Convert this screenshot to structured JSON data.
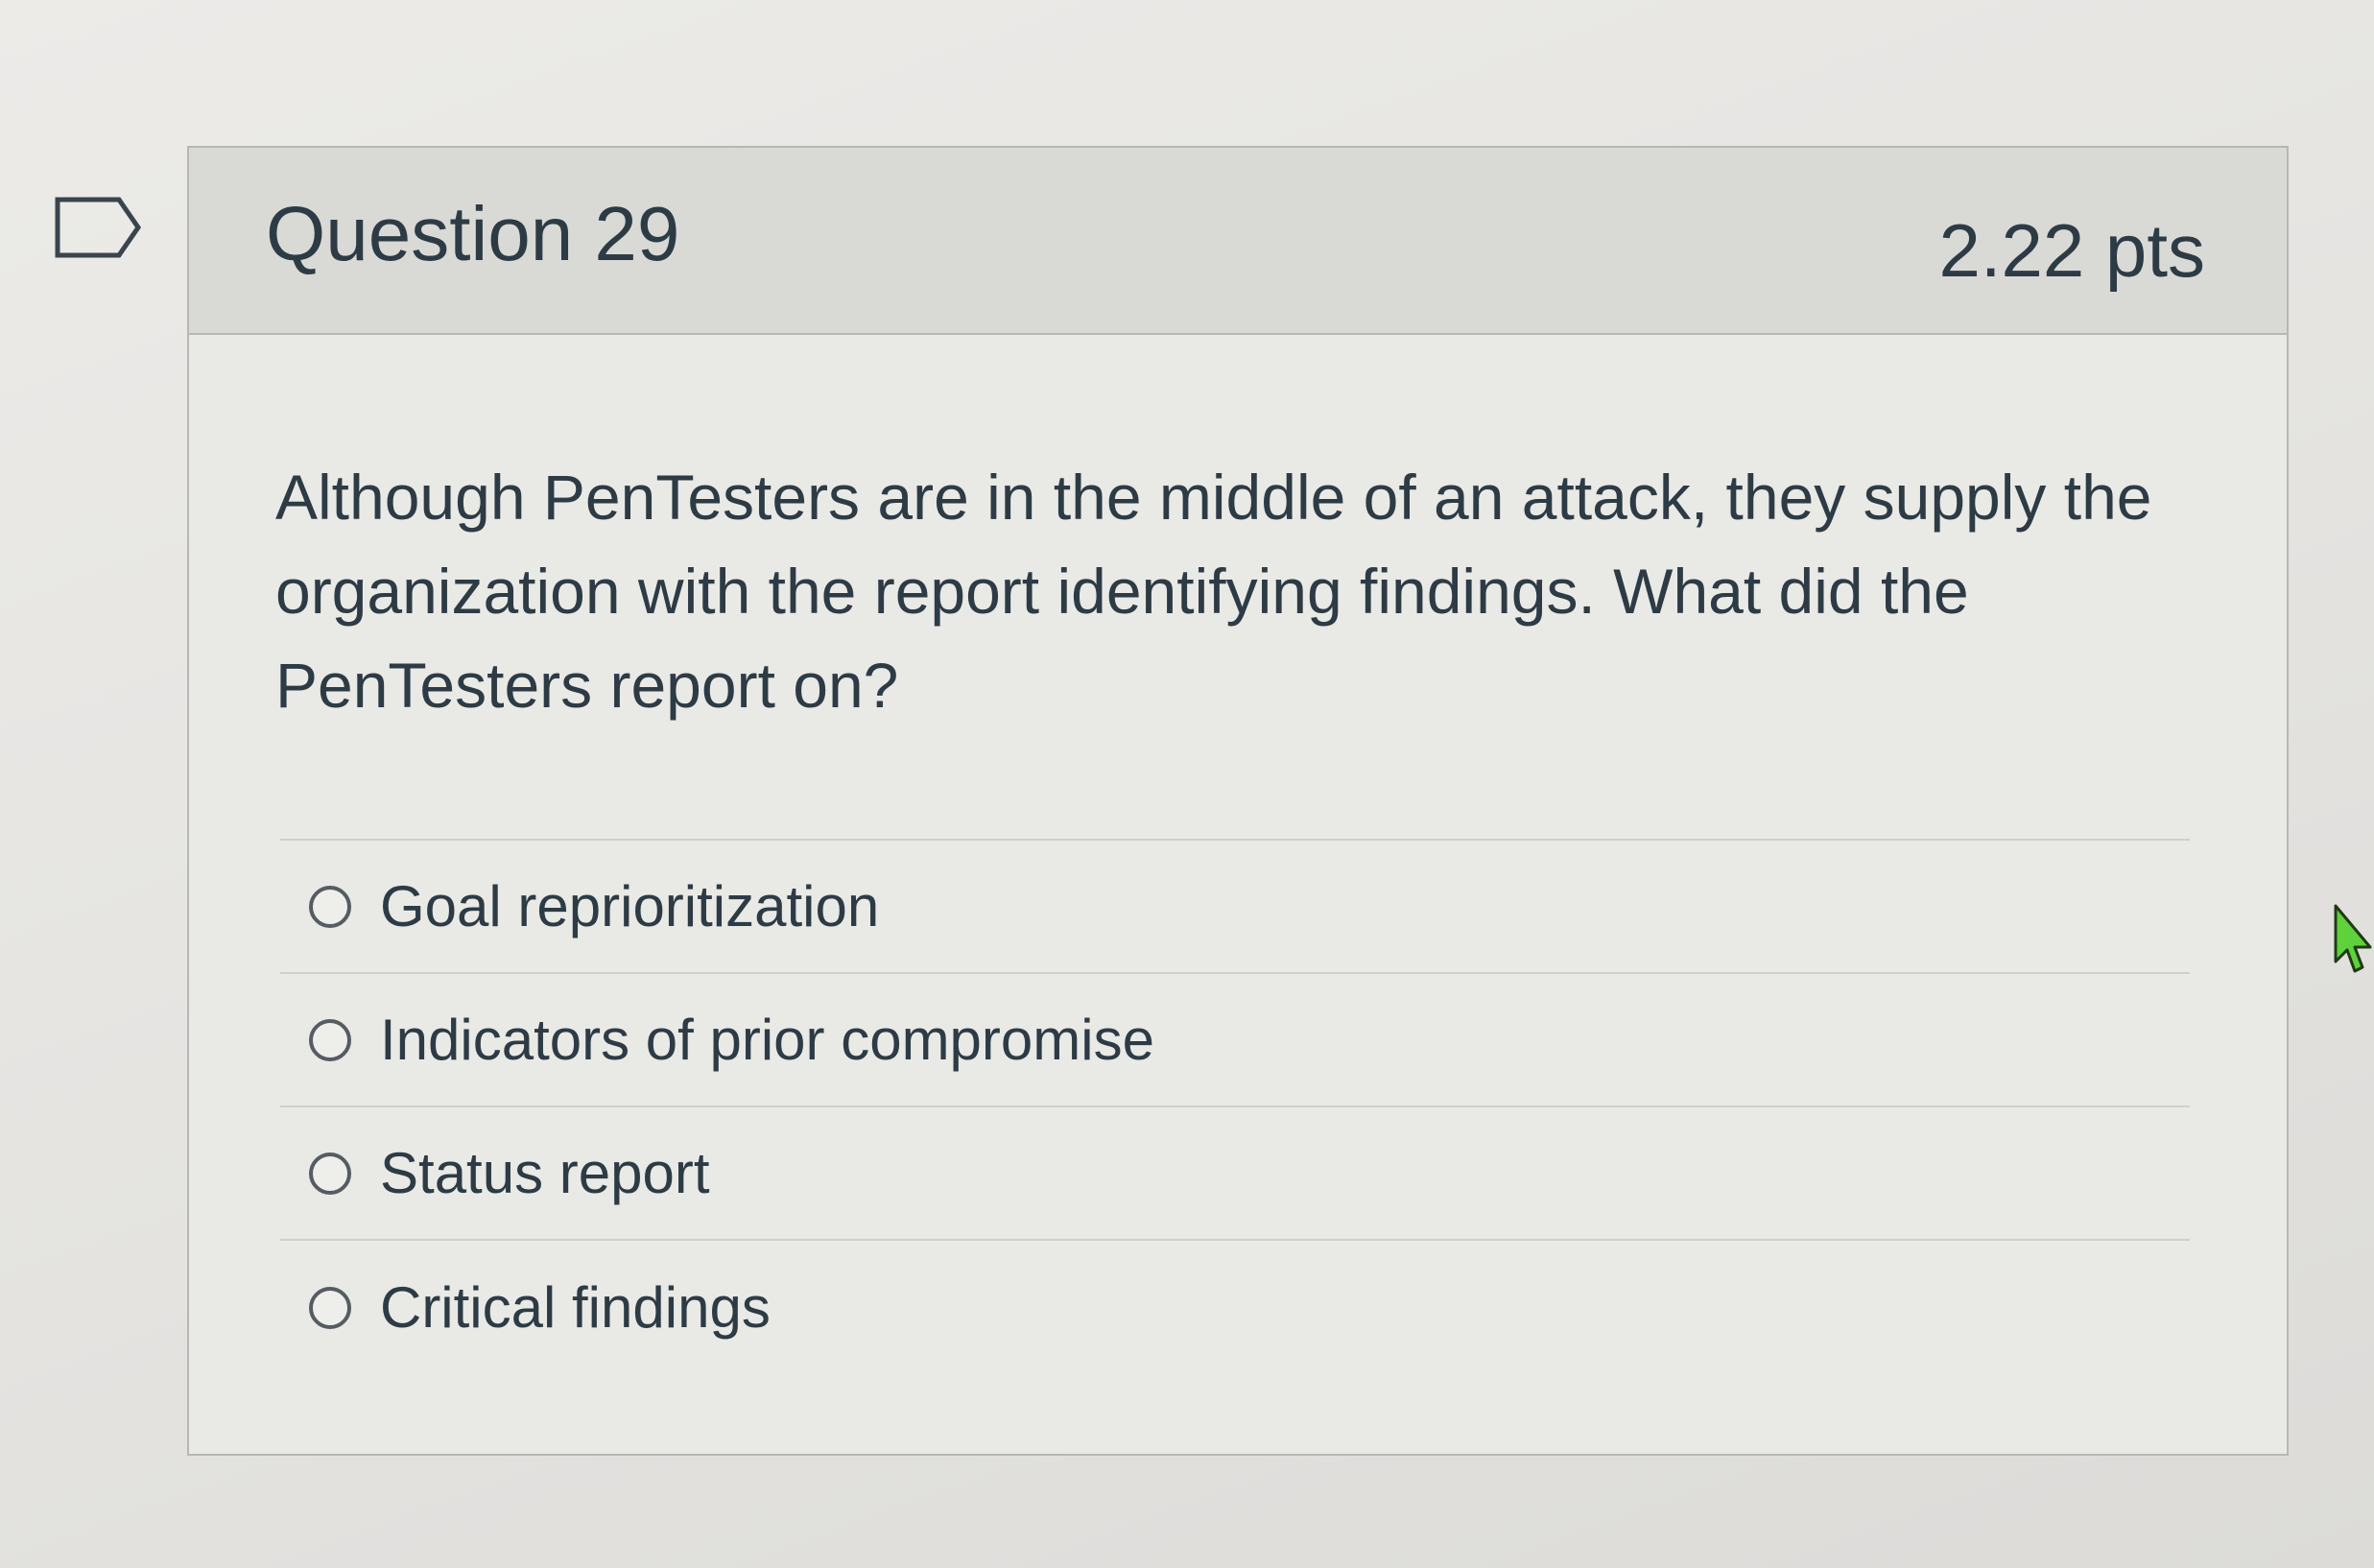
{
  "question": {
    "title": "Question 29",
    "points": "2.22 pts",
    "text": "Although PenTesters are in the middle of an attack, they supply the organization with the report identifying findings. What did the PenTesters report on?",
    "flag_icon": "flag-outline-icon"
  },
  "answers": [
    {
      "label": "Goal reprioritization",
      "selected": false
    },
    {
      "label": "Indicators of prior compromise",
      "selected": false
    },
    {
      "label": "Status report",
      "selected": false
    },
    {
      "label": "Critical findings",
      "selected": false
    }
  ],
  "cursor_icon": "pointer-cursor-icon"
}
